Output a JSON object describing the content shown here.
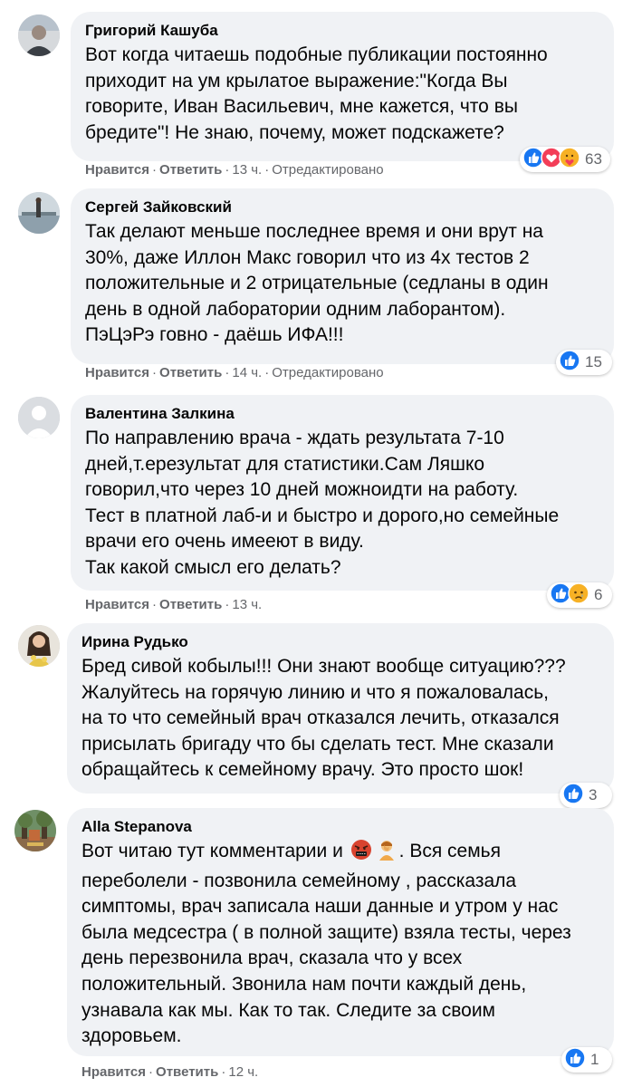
{
  "comments": [
    {
      "author": "Григорий Кашуба",
      "text": "Вот когда читаешь подобные публикации постоянно\nприходит на ум крылатое выражение:\"Когда Вы\nговорите, Иван Васильевич, мне кажется, что вы\nбредите\"! Не знаю, почему, может подскажете?",
      "like": "Нравится",
      "reply": "Ответить",
      "time": "13 ч.",
      "edited": "Отредактировано",
      "reaction_count": "63",
      "reaction_icons": [
        "like-icon",
        "love-icon",
        "care-icon"
      ]
    },
    {
      "author": "Сергей Зайковский",
      "text": "Так делают меньше последнее время и они врут на\n30%, даже Иллон Макс говорил что из 4х тестов 2\nположительные и 2 отрицательные (седланы в один\nдень в одной лаборатории одним лаборантом).\nПэЦэРэ говно - даёшь ИФА!!!",
      "like": "Нравится",
      "reply": "Ответить",
      "time": "14 ч.",
      "edited": "Отредактировано",
      "reaction_count": "15",
      "reaction_icons": [
        "like-icon"
      ]
    },
    {
      "author": "Валентина Залкина",
      "text": "По направлению врача - ждать результата 7-10\nдней,т.ерезультат для статистики.Сам Ляшко\nговорил,что через 10 дней можноидти на работу.\nТест в платной лаб-и и быстро и дорого,но семейные\nврачи его очень имееют в виду.\nТак какой смысл его делать?",
      "like": "Нравится",
      "reply": "Ответить",
      "time": "13 ч.",
      "reaction_count": "6",
      "reaction_icons": [
        "like-icon",
        "sad-icon"
      ]
    },
    {
      "author": "Ирина Рудько",
      "text": "Бред сивой кобылы!!! Они знают вообще ситуацию???\nЖалуйтесь на горячую линию и что я пожаловалась,\nна то что семейный врач отказался лечить, отказался\nприсылать бригаду что бы сделать тест. Мне сказали\nобращайтесь к семейному врачу. Это просто шок!",
      "reaction_count": "3",
      "reaction_icons": [
        "like-icon"
      ]
    },
    {
      "author": "Alla Stepanova",
      "text_before": "Вот читаю тут комментарии и",
      "text_after": ". Вся семья",
      "text": "переболели - позвонила семейному , рассказала\nсимптомы, врач записала наши данные и утром у нас\nбыла медсестра ( в полной защите) взяла тесты, через\nдень перезвонила врач, сказала что у всех\nположительный. Звонила нам почти каждый день,\nузнавала как мы. Как то так. Следите за своим\nздоровьем.",
      "inline_icons": [
        "angry-cursing-face-icon",
        "person-facepalming-icon"
      ],
      "like": "Нравится",
      "reply": "Ответить",
      "time": "12 ч.",
      "reaction_count": "1",
      "reaction_icons": [
        "like-icon"
      ]
    }
  ],
  "colors": {
    "bubble": "#f0f2f5",
    "meta": "#65676b",
    "like_blue": "#1877f2",
    "love_red": "#f33e58",
    "emoji_yellow": "#f7b125"
  }
}
